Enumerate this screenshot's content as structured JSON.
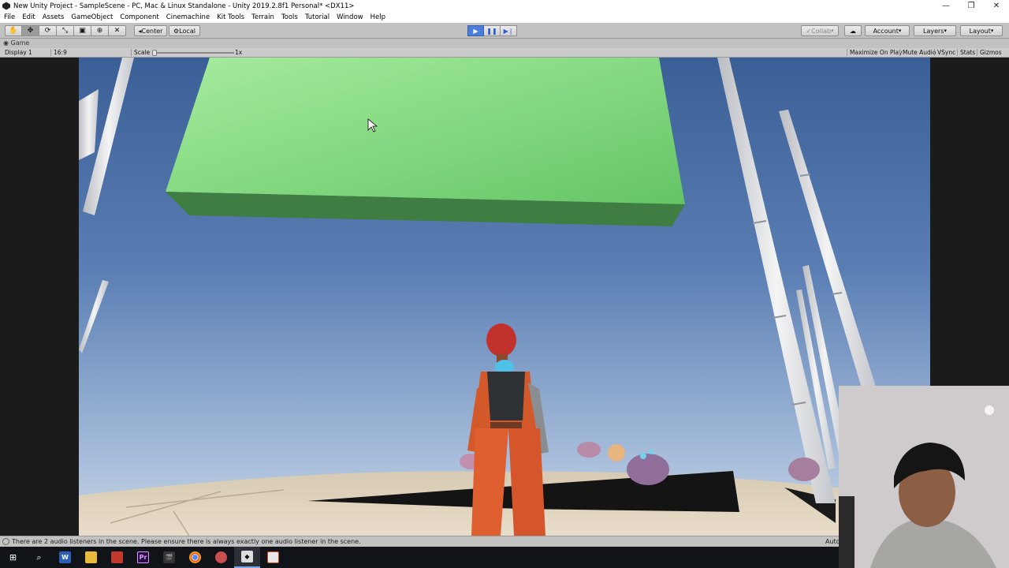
{
  "window": {
    "title": "New Unity Project - SampleScene - PC, Mac & Linux Standalone - Unity 2019.2.8f1 Personal* <DX11>",
    "controls": [
      "—",
      "❐",
      "✕"
    ]
  },
  "menu": [
    "File",
    "Edit",
    "Assets",
    "GameObject",
    "Component",
    "Cinemachine",
    "Kit Tools",
    "Terrain",
    "Tools",
    "Tutorial",
    "Window",
    "Help"
  ],
  "toolbar": {
    "tools": [
      "hand-tool",
      "move-tool",
      "rotate-tool",
      "scale-tool",
      "rect-tool",
      "transform-tool",
      "custom-tool"
    ],
    "pivot_label": "Center",
    "space_label": "Local",
    "collab_label": "Collab",
    "account_label": "Account",
    "layers_label": "Layers",
    "layout_label": "Layout"
  },
  "game": {
    "tab_label": "Game",
    "display": "Display 1",
    "aspect": "16:9",
    "scale_label": "Scale",
    "scale_value": "1x",
    "options": [
      "Maximize On Play",
      "Mute Audio",
      "VSync",
      "Stats",
      "Gizmos"
    ]
  },
  "status": {
    "message": "There are 2 audio listeners in the scene. Please ensure there is always exactly one audio listener in the scene.",
    "right": "Auto"
  },
  "taskbar": {
    "apps": [
      "start",
      "search",
      "word",
      "file-explorer",
      "photo-app",
      "premiere",
      "video-editor",
      "chrome",
      "screen-recorder",
      "unity",
      "presentation"
    ]
  }
}
